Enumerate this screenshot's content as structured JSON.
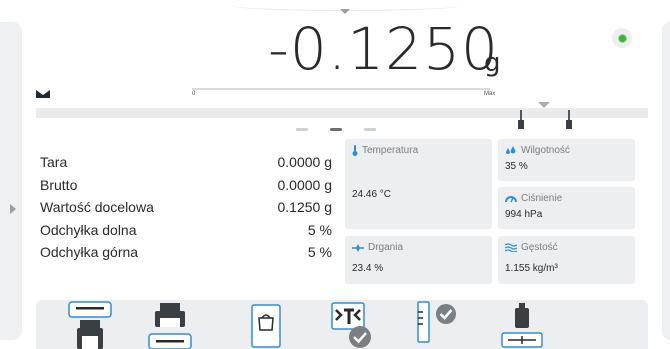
{
  "header": {
    "reading": "-0.1250",
    "unit": "g",
    "scale_min": "0",
    "scale_max": "Max"
  },
  "params": [
    {
      "label": "Tara",
      "value": "0.0000 g"
    },
    {
      "label": "Brutto",
      "value": "0.0000 g"
    },
    {
      "label": "Wartość docelowa",
      "value": "0.1250 g"
    },
    {
      "label": "Odchyłka dolna",
      "value": "5 %"
    },
    {
      "label": "Odchyłka górna",
      "value": "5 %"
    }
  ],
  "tiles": {
    "temperature": {
      "title": "Temperatura",
      "value": "24.46 °C"
    },
    "humidity": {
      "title": "Wilgotność",
      "value": "35 %"
    },
    "pressure": {
      "title": "Ciśnienie",
      "value": "994 hPa"
    },
    "vibration": {
      "title": "Drgania",
      "value": "23.4 %"
    },
    "density": {
      "title": "Gęstość",
      "value": "1.155 kg/m³"
    }
  },
  "icons": {
    "status": "status-led-icon",
    "stable": "stable-indicator-icon",
    "temperature": "thermometer-icon",
    "humidity": "droplets-icon",
    "pressure": "gauge-icon",
    "vibration": "vibration-icon",
    "density": "density-icon"
  },
  "colors": {
    "accent": "#2f8ed8",
    "status_led": "#3cb43c",
    "tile_bg": "#eceeef"
  },
  "pager": {
    "count": 3,
    "active": 1
  }
}
